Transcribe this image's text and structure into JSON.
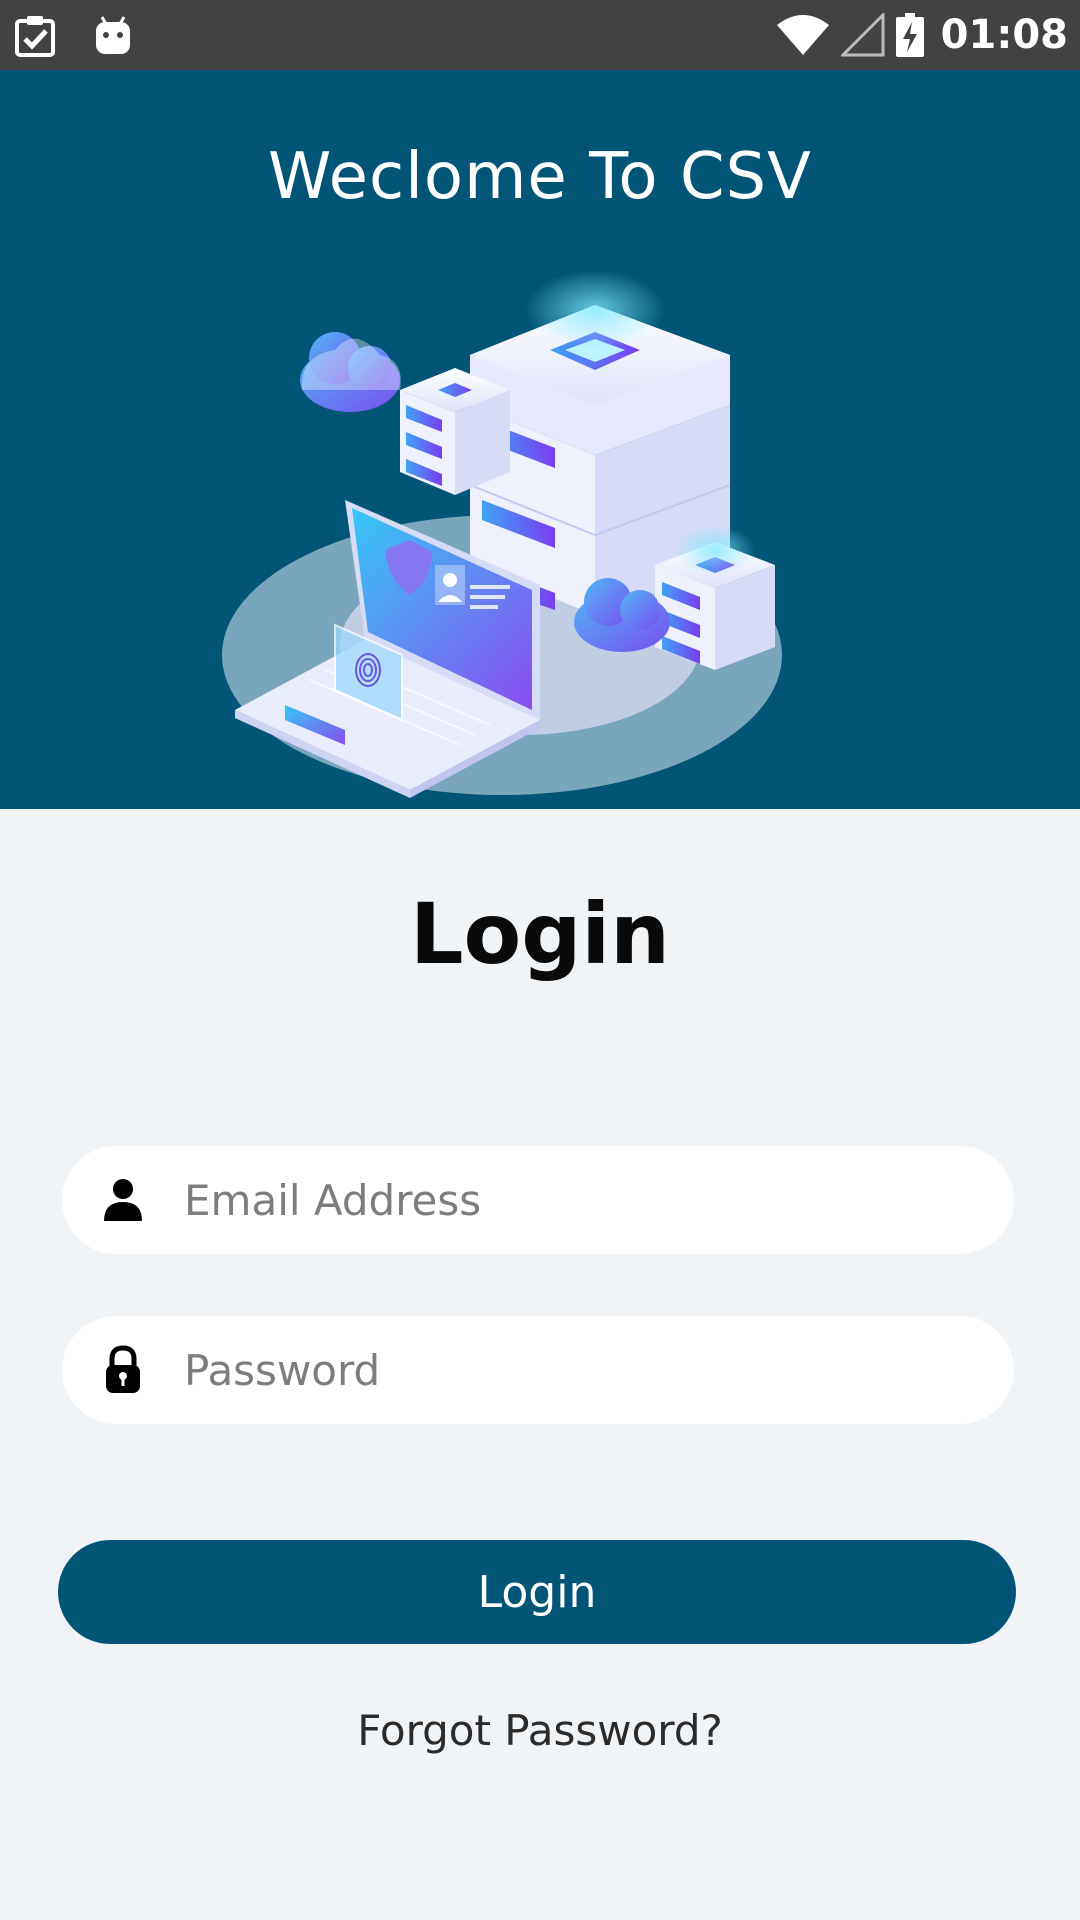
{
  "status_bar": {
    "time": "01:08",
    "left_icons": [
      "clipboard-check-icon",
      "android-icon"
    ],
    "right_icons": [
      "wifi-icon",
      "cell-signal-icon",
      "battery-charging-icon"
    ]
  },
  "header": {
    "title": "Weclome To CSV",
    "illustration": "server-security-illustration",
    "background_color": "#025577"
  },
  "login": {
    "title": "Login",
    "email": {
      "placeholder": "Email Address",
      "value": "",
      "icon": "person-icon"
    },
    "password": {
      "placeholder": "Password",
      "value": "",
      "icon": "lock-icon"
    },
    "button_label": "Login",
    "forgot_label": "Forgot Password?"
  },
  "colors": {
    "primary": "#025577",
    "background": "#f1f4f7",
    "status_bar": "#424242"
  }
}
